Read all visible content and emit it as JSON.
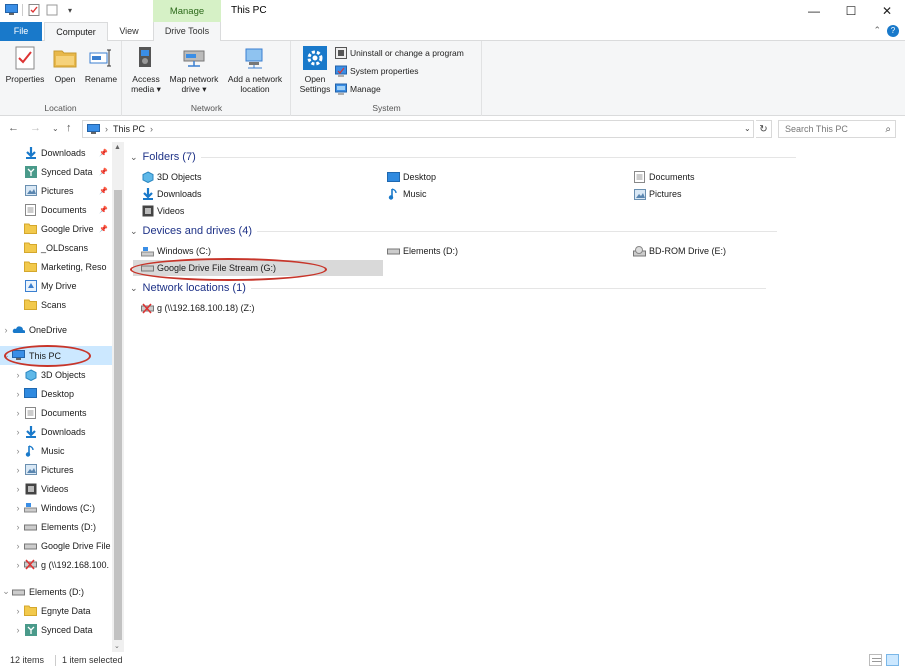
{
  "window": {
    "title": "This PC",
    "context_tab": "Manage",
    "minimize": "—",
    "maximize": "☐",
    "close": "✕"
  },
  "tabs": {
    "file": "File",
    "computer": "Computer",
    "view": "View",
    "drive_tools": "Drive Tools"
  },
  "ribbon": {
    "location": {
      "label": "Location",
      "properties": "Properties",
      "open": "Open",
      "rename": "Rename"
    },
    "network": {
      "label": "Network",
      "access_media": "Access\nmedia ▾",
      "map_network_drive": "Map network\ndrive ▾",
      "add_network_location": "Add a network\nlocation"
    },
    "system": {
      "label": "System",
      "open_settings": "Open\nSettings",
      "uninstall": "Uninstall or change a program",
      "system_properties": "System properties",
      "manage": "Manage"
    }
  },
  "address": {
    "path": "This PC",
    "search_placeholder": "Search This PC"
  },
  "navpane": {
    "quick_access": [
      {
        "label": "Downloads",
        "pinned": true
      },
      {
        "label": "Synced Data",
        "pinned": true
      },
      {
        "label": "Pictures",
        "pinned": true
      },
      {
        "label": "Documents",
        "pinned": true
      },
      {
        "label": "Google Drive",
        "pinned": true
      },
      {
        "label": "_OLDscans",
        "pinned": false
      },
      {
        "label": "Marketing, Reso",
        "pinned": false
      },
      {
        "label": "My Drive",
        "pinned": false
      },
      {
        "label": "Scans",
        "pinned": false
      }
    ],
    "onedrive": "OneDrive",
    "this_pc": "This PC",
    "this_pc_children": [
      "3D Objects",
      "Desktop",
      "Documents",
      "Downloads",
      "Music",
      "Pictures",
      "Videos",
      "Windows  (C:)",
      "Elements (D:)",
      "Google Drive File",
      "g (\\\\192.168.100."
    ],
    "elements_drive": "Elements (D:)",
    "elements_children": [
      "Egnyte Data",
      "Synced Data"
    ],
    "pin_glyph": "📌"
  },
  "content": {
    "folders_header": "Folders (7)",
    "folders": [
      {
        "label": "3D Objects",
        "icon": "3d-objects-icon"
      },
      {
        "label": "Desktop",
        "icon": "desktop-icon"
      },
      {
        "label": "Documents",
        "icon": "documents-icon"
      },
      {
        "label": "Downloads",
        "icon": "downloads-icon"
      },
      {
        "label": "Music",
        "icon": "music-icon"
      },
      {
        "label": "Pictures",
        "icon": "pictures-icon"
      },
      {
        "label": "Videos",
        "icon": "videos-icon"
      }
    ],
    "drives_header": "Devices and drives (4)",
    "drives": [
      {
        "label": "Windows  (C:)"
      },
      {
        "label": "Elements (D:)"
      },
      {
        "label": "BD-ROM Drive (E:)"
      },
      {
        "label": "Google Drive File Stream (G:)"
      }
    ],
    "network_header": "Network locations (1)",
    "network": [
      {
        "label": "g (\\\\192.168.100.18) (Z:)"
      }
    ]
  },
  "status": {
    "items": "12 items",
    "selected": "1 item selected"
  },
  "colors": {
    "accent": "#1979ca",
    "selection": "#cce8ff",
    "highlight_ring": "#c7352a",
    "section_header": "#1e3287"
  }
}
